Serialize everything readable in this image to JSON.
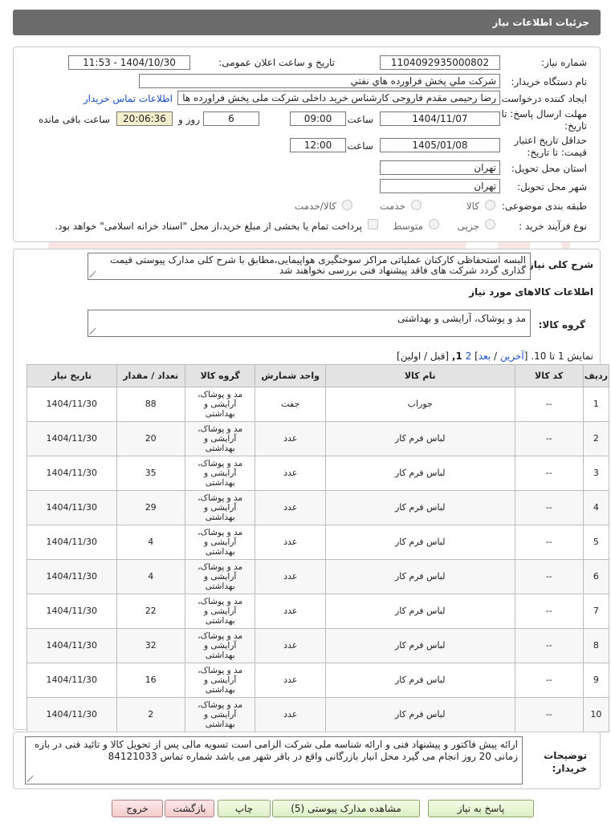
{
  "header": {
    "title": "جزئیات اطلاعات نیاز"
  },
  "form": {
    "need_number": {
      "label": "شماره نیاز:",
      "value": "1104092935000802"
    },
    "announce_datetime": {
      "label": "تاریخ و ساعت اعلان عمومی:",
      "value": "1404/10/30 - 11:53"
    },
    "buyer_org": {
      "label": "نام دستگاه خریدار:",
      "value": "شرکت ملي پخش فراورده هاي نفتي"
    },
    "requester": {
      "label": "ایجاد کننده درخواست:",
      "value": "رضا رحیمی مقدم فاروجی  کارشناس خرید داخلی شرکت ملی پخش فراورده ها",
      "contact_link": "اطلاعات تماس خریدار"
    },
    "reply_deadline": {
      "label_line1": "مهلت ارسال پاسخ: تا",
      "label_line2": "تاریخ:",
      "date": "1404/11/07",
      "time_label": "ساعت",
      "time": "09:00",
      "days": "6",
      "days_label": "روز و",
      "remaining": "20:06:36",
      "remaining_label": "ساعت باقی مانده"
    },
    "price_validity": {
      "label_line1": "حداقل تاریخ اعتبار",
      "label_line2": "قیمت: تا تاریخ:",
      "date": "1405/01/08",
      "time_label": "ساعت",
      "time": "12:00"
    },
    "province": {
      "label": "استان محل تحویل:",
      "value": "تهران"
    },
    "city": {
      "label": "شهر محل تحویل:",
      "value": "تهران"
    },
    "category": {
      "label": "طبقه بندی موضوعی:",
      "options": [
        "کالا",
        "خدمت",
        "کالا/خدمت"
      ]
    },
    "purchase_type": {
      "label": "نوع فرآیند خرید :",
      "options": [
        "جزیی",
        "متوسط"
      ],
      "note": "پرداخت تمام یا بخشی از مبلغ خرید،از محل \"اسناد خزانه اسلامی\" خواهد بود."
    }
  },
  "description": {
    "label": "شرح کلی نیاز:",
    "text": "البسه استحفاظی کارکنان عملیاتی مراکز سوختگیری هواپیمایی،مطابق با شرح کلی مدارک پیوستی قیمت گذاری گردد شرکت های فاقد پیشنهاد فنی بررسی نخواهند شد"
  },
  "goods_info": {
    "title": "اطلاعات کالاهای مورد نیاز",
    "group_label": "گروه کالا:",
    "group_value": "مد و پوشاک، آرایشی و بهداشتی"
  },
  "pagination": {
    "prefix": "نمایش 1 تا 10. [",
    "last": "آخرین",
    "sep1": " / ",
    "next": "بعد",
    "page2": "2",
    "current": "1,",
    "suffix": "[قبل / اولین]",
    "close": "]"
  },
  "table": {
    "columns": [
      "ردیف",
      "کد کالا",
      "نام کالا",
      "واحد شمارش",
      "گروه کالا",
      "تعداد / مقدار",
      "تاریخ نیاز"
    ],
    "rows": [
      {
        "idx": "1",
        "code": "--",
        "name": "جوراب",
        "unit": "جفت",
        "group": "مد و پوشاک، آرایشی و بهداشتی",
        "qty": "88",
        "date": "1404/11/30"
      },
      {
        "idx": "2",
        "code": "--",
        "name": "لباس فرم کار",
        "unit": "عدد",
        "group": "مد و پوشاک، آرایشی و بهداشتی",
        "qty": "20",
        "date": "1404/11/30"
      },
      {
        "idx": "3",
        "code": "--",
        "name": "لباس فرم کار",
        "unit": "عدد",
        "group": "مد و پوشاک، آرایشی و بهداشتی",
        "qty": "35",
        "date": "1404/11/30"
      },
      {
        "idx": "4",
        "code": "--",
        "name": "لباس فرم کار",
        "unit": "عدد",
        "group": "مد و پوشاک، آرایشی و بهداشتی",
        "qty": "29",
        "date": "1404/11/30"
      },
      {
        "idx": "5",
        "code": "--",
        "name": "لباس فرم کار",
        "unit": "عدد",
        "group": "مد و پوشاک، آرایشی و بهداشتی",
        "qty": "4",
        "date": "1404/11/30"
      },
      {
        "idx": "6",
        "code": "--",
        "name": "لباس فرم کار",
        "unit": "عدد",
        "group": "مد و پوشاک، آرایشی و بهداشتی",
        "qty": "4",
        "date": "1404/11/30"
      },
      {
        "idx": "7",
        "code": "--",
        "name": "لباس فرم کار",
        "unit": "عدد",
        "group": "مد و پوشاک، آرایشی و بهداشتی",
        "qty": "22",
        "date": "1404/11/30"
      },
      {
        "idx": "8",
        "code": "--",
        "name": "لباس فرم کار",
        "unit": "عدد",
        "group": "مد و پوشاک، آرایشی و بهداشتی",
        "qty": "32",
        "date": "1404/11/30"
      },
      {
        "idx": "9",
        "code": "--",
        "name": "لباس فرم کار",
        "unit": "عدد",
        "group": "مد و پوشاک، آرایشی و بهداشتی",
        "qty": "16",
        "date": "1404/11/30"
      },
      {
        "idx": "10",
        "code": "--",
        "name": "لباس فرم کار",
        "unit": "عدد",
        "group": "مد و پوشاک، آرایشی و بهداشتی",
        "qty": "2",
        "date": "1404/11/30"
      }
    ]
  },
  "buyer_notes": {
    "label_line1": "توضیحات",
    "label_line2": "خریدار:",
    "text": "ارائه پیش فاکتور و پیشنهاد فنی و ارائه شناسه ملی شرکت الزامی است تسویه مالی پس از تحویل کالا و تائید فنی در بازه زمانی 20 روز انجام می گیرد محل انبار بازرگانی واقع در باقر شهر می باشد شماره تماس 84121033"
  },
  "buttons": {
    "reply": "پاسخ به نیاز",
    "attachments": "مشاهده مدارک پیوستی (5)",
    "print": "چاپ",
    "back": "بازگشت",
    "exit": "خروج"
  },
  "colors": {
    "header_bg": "#6b6b6b",
    "link": "#1a4ec9",
    "remaining_bg": "#f5eecd"
  }
}
